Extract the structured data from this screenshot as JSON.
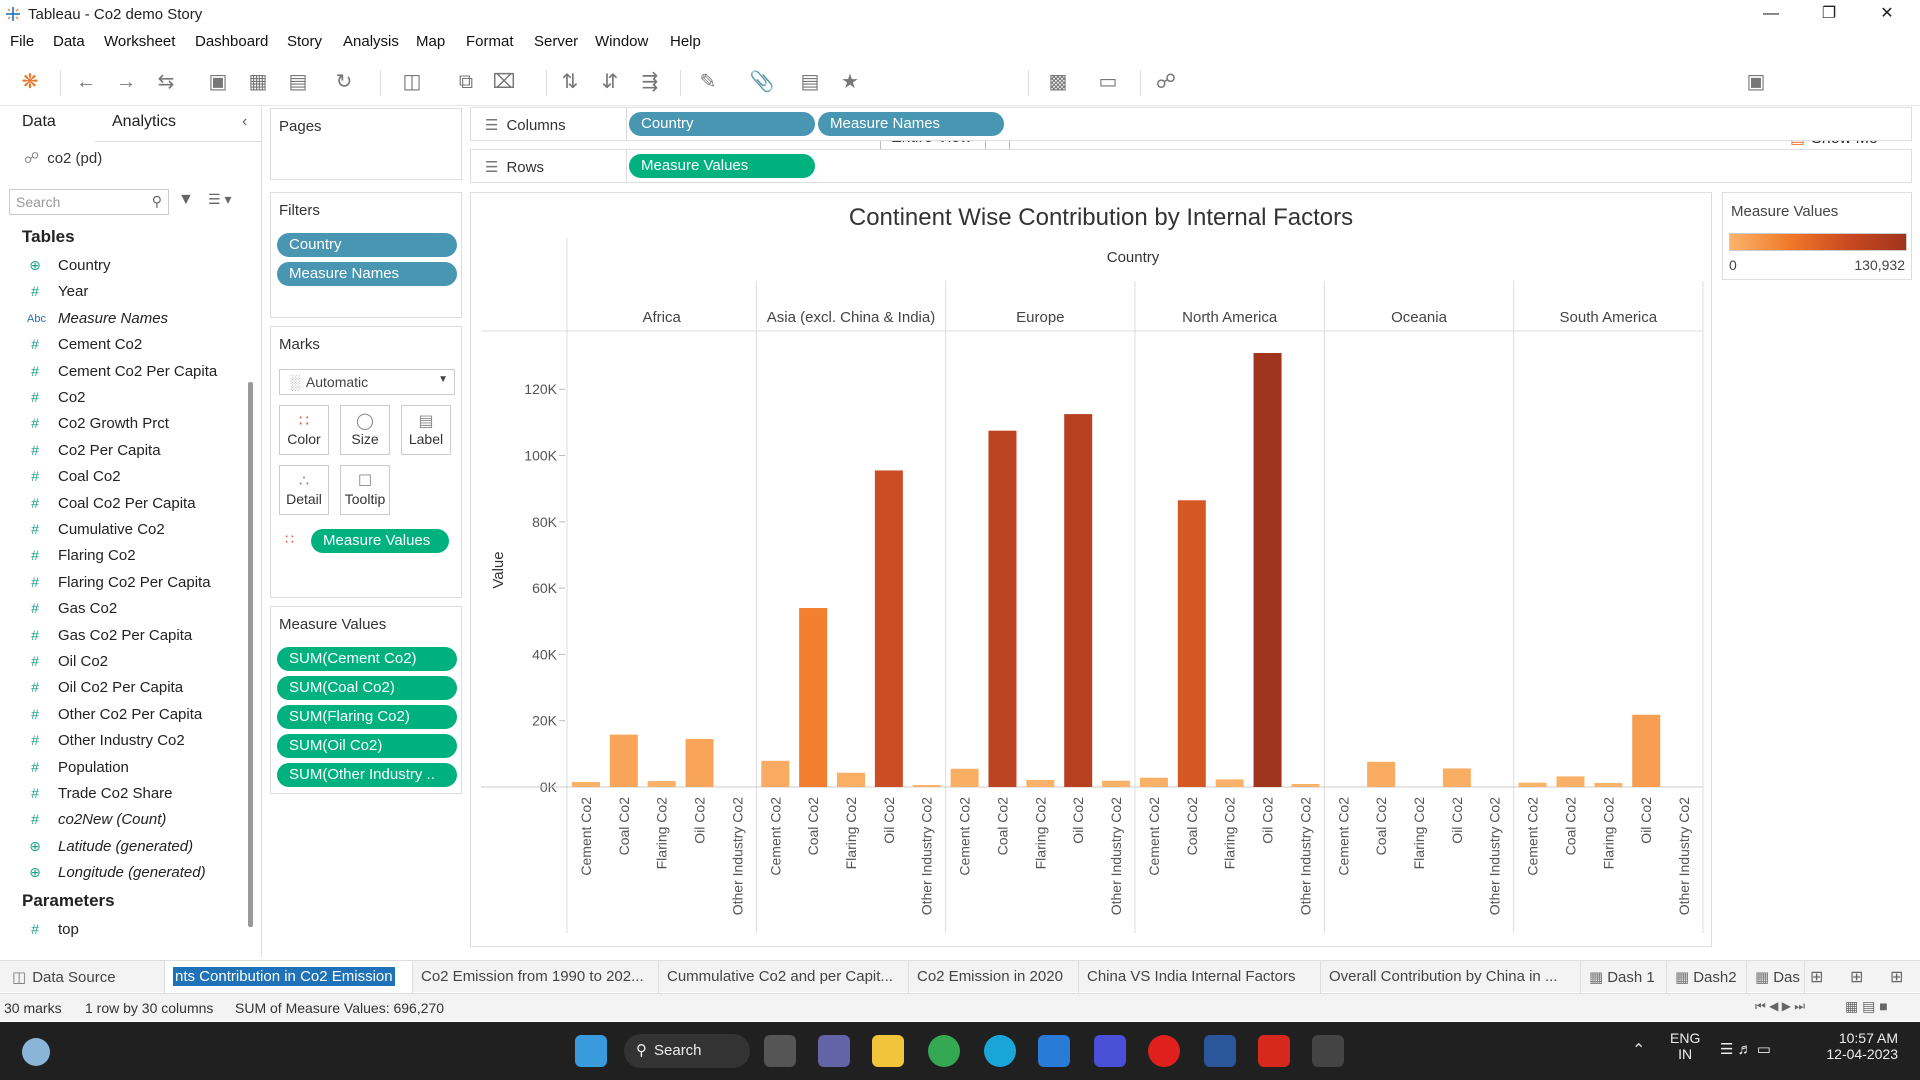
{
  "window": {
    "title": "Tableau - Co2 demo Story"
  },
  "menu": [
    "File",
    "Data",
    "Worksheet",
    "Dashboard",
    "Story",
    "Analysis",
    "Map",
    "Format",
    "Server",
    "Window",
    "Help"
  ],
  "toolbar": {
    "fit_mode": "Entire View",
    "show_me": "Show Me"
  },
  "data_pane": {
    "tabs": [
      "Data",
      "Analytics"
    ],
    "datasource": "co2 (pd)",
    "search_placeholder": "Search",
    "tables_heading": "Tables",
    "fields": [
      {
        "name": "Country",
        "kind": "geo"
      },
      {
        "name": "Year",
        "kind": "measure"
      },
      {
        "name": "Measure Names",
        "kind": "string",
        "italic": true
      },
      {
        "name": "Cement Co2",
        "kind": "measure"
      },
      {
        "name": "Cement Co2 Per Capita",
        "kind": "measure"
      },
      {
        "name": "Co2",
        "kind": "measure"
      },
      {
        "name": "Co2 Growth Prct",
        "kind": "measure"
      },
      {
        "name": "Co2 Per Capita",
        "kind": "measure"
      },
      {
        "name": "Coal Co2",
        "kind": "measure"
      },
      {
        "name": "Coal Co2 Per Capita",
        "kind": "measure"
      },
      {
        "name": "Cumulative Co2",
        "kind": "measure"
      },
      {
        "name": "Flaring Co2",
        "kind": "measure"
      },
      {
        "name": "Flaring Co2 Per Capita",
        "kind": "measure"
      },
      {
        "name": "Gas Co2",
        "kind": "measure"
      },
      {
        "name": "Gas Co2 Per Capita",
        "kind": "measure"
      },
      {
        "name": "Oil Co2",
        "kind": "measure"
      },
      {
        "name": "Oil Co2 Per Capita",
        "kind": "measure"
      },
      {
        "name": "Other Co2 Per Capita",
        "kind": "measure"
      },
      {
        "name": "Other Industry Co2",
        "kind": "measure"
      },
      {
        "name": "Population",
        "kind": "measure"
      },
      {
        "name": "Trade Co2 Share",
        "kind": "measure"
      },
      {
        "name": "co2New (Count)",
        "kind": "measure",
        "italic": true
      },
      {
        "name": "Latitude (generated)",
        "kind": "geo",
        "italic": true
      },
      {
        "name": "Longitude (generated)",
        "kind": "geo",
        "italic": true
      }
    ],
    "parameters_heading": "Parameters",
    "parameters": [
      {
        "name": "top",
        "kind": "measure"
      }
    ]
  },
  "pages_card": {
    "title": "Pages"
  },
  "filters_card": {
    "title": "Filters",
    "pills": [
      "Country",
      "Measure Names"
    ]
  },
  "marks_card": {
    "title": "Marks",
    "mark_type": "Automatic",
    "buttons": [
      "Color",
      "Size",
      "Label",
      "Detail",
      "Tooltip"
    ],
    "color_pill": "Measure Values"
  },
  "measure_values_card": {
    "title": "Measure Values",
    "pills": [
      "SUM(Cement Co2)",
      "SUM(Coal Co2)",
      "SUM(Flaring Co2)",
      "SUM(Oil Co2)",
      "SUM(Other Industry .."
    ]
  },
  "shelves": {
    "columns_label": "Columns",
    "columns_pills": [
      "Country",
      "Measure Names"
    ],
    "rows_label": "Rows",
    "rows_pills": [
      "Measure Values"
    ]
  },
  "legend": {
    "title": "Measure Values",
    "min_label": "0",
    "max_label": "130,932",
    "min_color": "#fbb36a",
    "max_color": "#a0341d",
    "min": 0,
    "max": 130932
  },
  "chart_data": {
    "type": "bar",
    "title": "Continent Wise Contribution by Internal Factors",
    "header_title": "Country",
    "ylabel": "Value",
    "ylim": [
      0,
      130932
    ],
    "yticks": [
      0,
      20000,
      40000,
      60000,
      80000,
      100000,
      120000
    ],
    "ytick_labels": [
      "0K",
      "20K",
      "40K",
      "60K",
      "80K",
      "100K",
      "120K"
    ],
    "measures": [
      "Cement Co2",
      "Coal Co2",
      "Flaring Co2",
      "Oil Co2",
      "Other Industry Co2"
    ],
    "groups": [
      {
        "name": "Africa",
        "values": [
          1500,
          15800,
          1800,
          14500,
          0
        ]
      },
      {
        "name": "Asia (excl. China & India)",
        "values": [
          7900,
          54000,
          4300,
          95500,
          600
        ]
      },
      {
        "name": "Europe",
        "values": [
          5500,
          107500,
          2100,
          112500,
          1900
        ]
      },
      {
        "name": "North America",
        "values": [
          2800,
          86500,
          2300,
          130932,
          900
        ]
      },
      {
        "name": "Oceania",
        "values": [
          0,
          7600,
          0,
          5600,
          0
        ]
      },
      {
        "name": "South America",
        "values": [
          1300,
          3200,
          1200,
          21800,
          0
        ]
      }
    ]
  },
  "sheet_tabs": {
    "data_source": "Data Source",
    "sheets": [
      "nts Contribution in Co2 Emission",
      "Co2 Emission from 1990 to 202...",
      "Cummulative Co2 and per Capit...",
      "Co2 Emission in 2020",
      "China VS India Internal Factors",
      "Overall Contribution by China in ...",
      "Dash 1",
      "Dash2",
      "Das"
    ]
  },
  "status": {
    "marks": "30 marks",
    "dims": "1 row by 30 columns",
    "sum": "SUM of Measure Values: 696,270"
  },
  "taskbar": {
    "search": "Search",
    "lang1": "ENG",
    "lang2": "IN",
    "time": "10:57 AM",
    "date": "12-04-2023"
  }
}
